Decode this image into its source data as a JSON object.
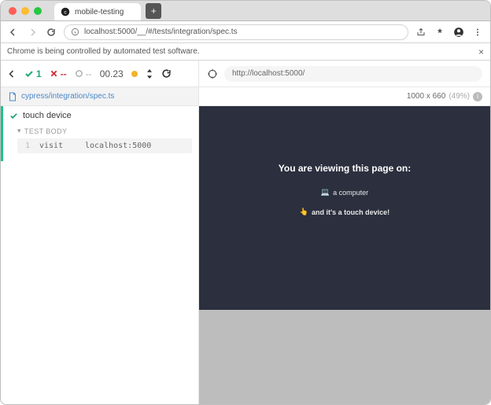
{
  "browser": {
    "tab_title": "mobile-testing",
    "address": "localhost:5000/__/#/tests/integration/spec.ts",
    "automation_notice": "Chrome is being controlled by automated test software."
  },
  "cypress": {
    "stats": {
      "passed": "1",
      "failed": "--",
      "pending": "--",
      "duration": "00.23"
    },
    "url": "http://localhost:5000/",
    "spec_file": "cypress/integration/spec.ts",
    "viewport": {
      "dimensions": "1000 x 660",
      "scale": "(49%)"
    }
  },
  "reporter": {
    "test_title": "touch device",
    "test_body_label": "TEST BODY",
    "commands": [
      {
        "index": "1",
        "name": "visit",
        "message": "localhost:5000"
      }
    ]
  },
  "app_under_test": {
    "headline": "You are viewing this page on:",
    "device_emoji": "💻",
    "device_text": "a computer",
    "touch_emoji": "👆",
    "touch_text": "and it's a touch device!"
  }
}
